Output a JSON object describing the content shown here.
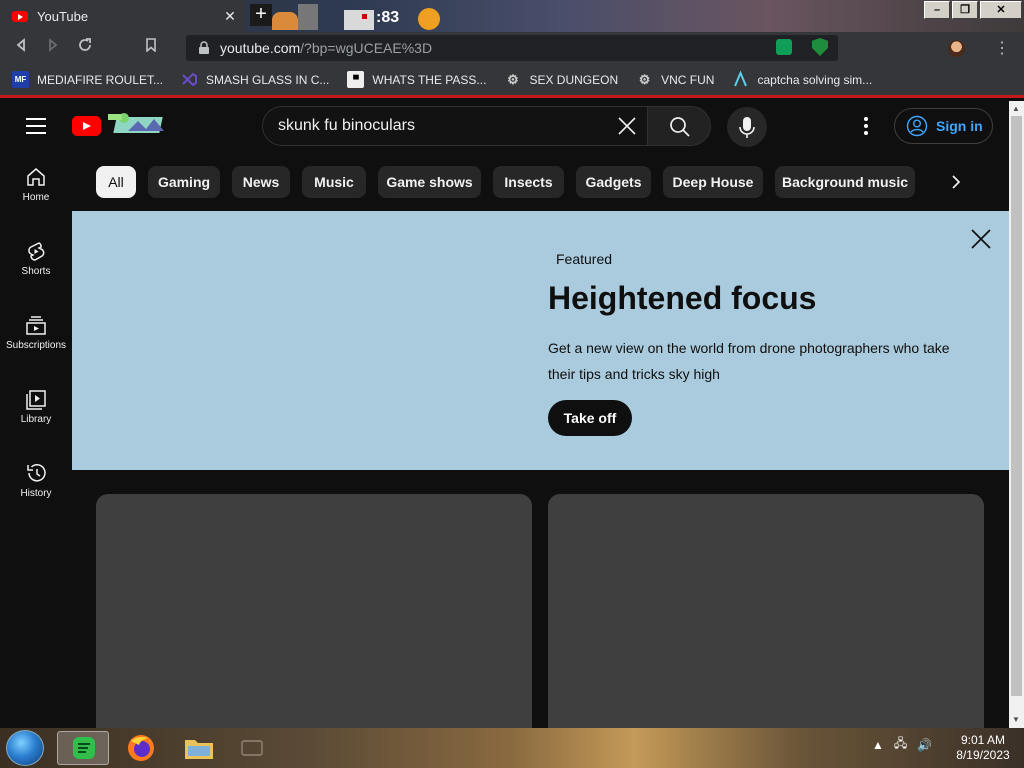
{
  "browser": {
    "tab_title": "YouTube",
    "tab_close": "✕",
    "new_tab": "+",
    "titlebar_overlay_text": ":83",
    "url_host": "youtube.com",
    "url_path": "/?bp=wgUCEAE%3D",
    "window_controls": {
      "minimize": "–",
      "maximize": "❐",
      "close": "✕"
    },
    "menu_glyph": "⋮"
  },
  "bookmarks": [
    {
      "label": "MEDIAFIRE ROULET...",
      "icon": "mediafire-icon",
      "color": "#1f3fa8"
    },
    {
      "label": "SMASH GLASS IN C...",
      "icon": "visualstudio-icon",
      "color": "#6a4cc7"
    },
    {
      "label": "WHATS THE PASS...",
      "icon": "terminal-icon",
      "color": "#222222"
    },
    {
      "label": "SEX DUNGEON",
      "icon": "gear-icon",
      "color": "#cccccc"
    },
    {
      "label": "VNC FUN",
      "icon": "gear-icon",
      "color": "#cccccc"
    },
    {
      "label": "captcha solving sim...",
      "icon": "arrow-icon",
      "color": "#5ad0e8"
    }
  ],
  "youtube": {
    "search_query": "skunk fu binoculars",
    "signin_label": "Sign in",
    "sidebar": [
      {
        "label": "Home",
        "icon": "home-icon"
      },
      {
        "label": "Shorts",
        "icon": "shorts-icon"
      },
      {
        "label": "Subscriptions",
        "icon": "subscriptions-icon"
      },
      {
        "label": "Library",
        "icon": "library-icon"
      },
      {
        "label": "History",
        "icon": "history-icon"
      }
    ],
    "chips": [
      "All",
      "Gaming",
      "News",
      "Music",
      "Game shows",
      "Insects",
      "Gadgets",
      "Deep House",
      "Background music"
    ],
    "active_chip": "All",
    "banner": {
      "eyebrow": "Featured",
      "title": "Heightened focus",
      "description": "Get a new view on the world from drone photographers who take their tips and tricks sky high",
      "cta": "Take off",
      "background": "#a9cbdd"
    }
  },
  "taskbar": {
    "time": "9:01 AM",
    "date": "8/19/2023"
  },
  "colors": {
    "yt_red": "#ff0000",
    "yt_bg": "#0f0f0f",
    "link_blue": "#3ea6ff",
    "chip_bg": "#272727"
  }
}
